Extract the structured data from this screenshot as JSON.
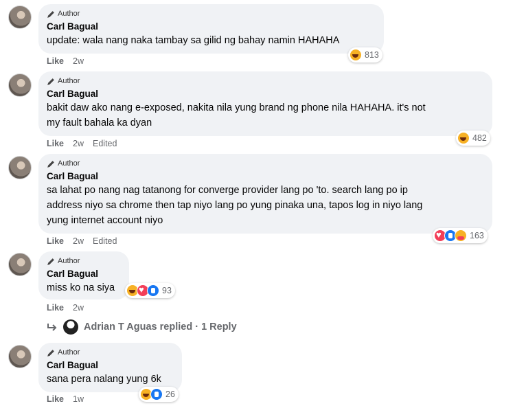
{
  "author_badge": "Author",
  "like_label": "Like",
  "comments": [
    {
      "name": "Carl Bagual",
      "text_lines": [
        "update: wala nang naka tambay sa gilid ng bahay namin HAHAHA"
      ],
      "time": "2w",
      "edited": "",
      "reactions": [
        "haha"
      ],
      "count": "813"
    },
    {
      "name": "Carl Bagual",
      "text_lines": [
        "bakit daw ako nang e-exposed, nakita nila yung brand ng phone nila HAHAHA. it's not",
        "my fault bahala ka dyan"
      ],
      "time": "2w",
      "edited": "Edited",
      "reactions": [
        "haha"
      ],
      "count": "482"
    },
    {
      "name": "Carl Bagual",
      "text_lines": [
        "sa lahat po nang nag tatanong for converge provider lang po 'to. search lang po ip",
        "address niyo sa chrome then tap niyo lang po yung pinaka una, tapos log in niyo lang",
        "yung internet account niyo"
      ],
      "time": "2w",
      "edited": "Edited",
      "reactions": [
        "heart",
        "like",
        "care"
      ],
      "count": "163"
    },
    {
      "name": "Carl Bagual",
      "text_lines": [
        "miss ko na siya"
      ],
      "time": "2w",
      "edited": "",
      "reactions": [
        "haha",
        "heart",
        "like"
      ],
      "count": "93"
    },
    {
      "name": "Carl Bagual",
      "text_lines": [
        "sana pera nalang yung 6k"
      ],
      "time": "1w",
      "edited": "",
      "reactions": [
        "haha",
        "like"
      ],
      "count": "26"
    }
  ],
  "reply": {
    "text": "Adrian T Aguas replied · 1 Reply"
  }
}
